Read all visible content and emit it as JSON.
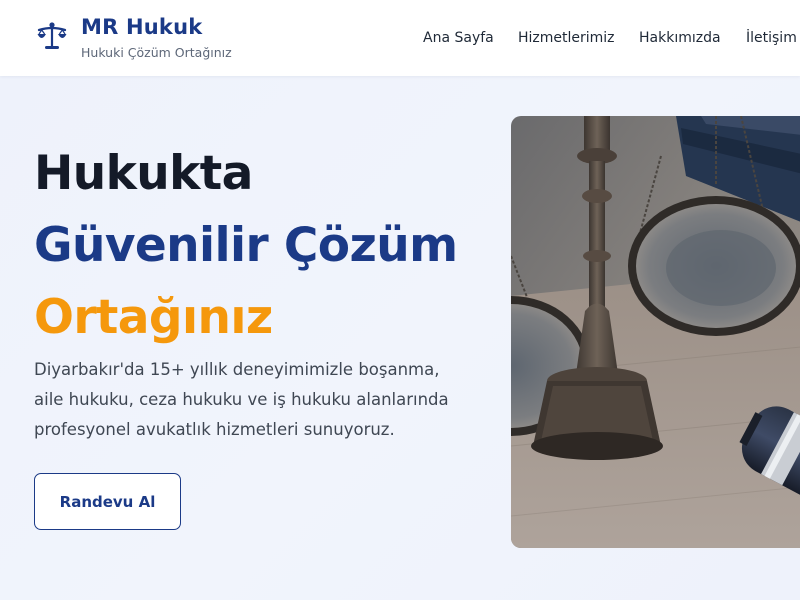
{
  "brand": {
    "name": "MR Hukuk",
    "tagline": "Hukuki Çözüm Ortağınız",
    "icon": "scales-of-justice-icon"
  },
  "nav": [
    {
      "label": "Ana Sayfa"
    },
    {
      "label": "Hizmetlerimiz"
    },
    {
      "label": "Hakkımızda"
    },
    {
      "label": "İletişim"
    }
  ],
  "hero": {
    "title_line1": "Hukukta",
    "title_line2": "Güvenilir Çözüm",
    "title_line3": "Ortağınız",
    "description": "Diyarbakır'da 15+ yıllık deneyimimizle boşanma, aile hukuku, ceza hukuku ve iş hukuku alanlarında profesyonel avukatlık hizmetleri sunuyoruz.",
    "cta_label": "Randevu Al",
    "image": "scales-of-justice-and-gavel-photo"
  },
  "colors": {
    "primary": "#1b3a87",
    "accent": "#f5980c",
    "text_dark": "#141a28"
  }
}
